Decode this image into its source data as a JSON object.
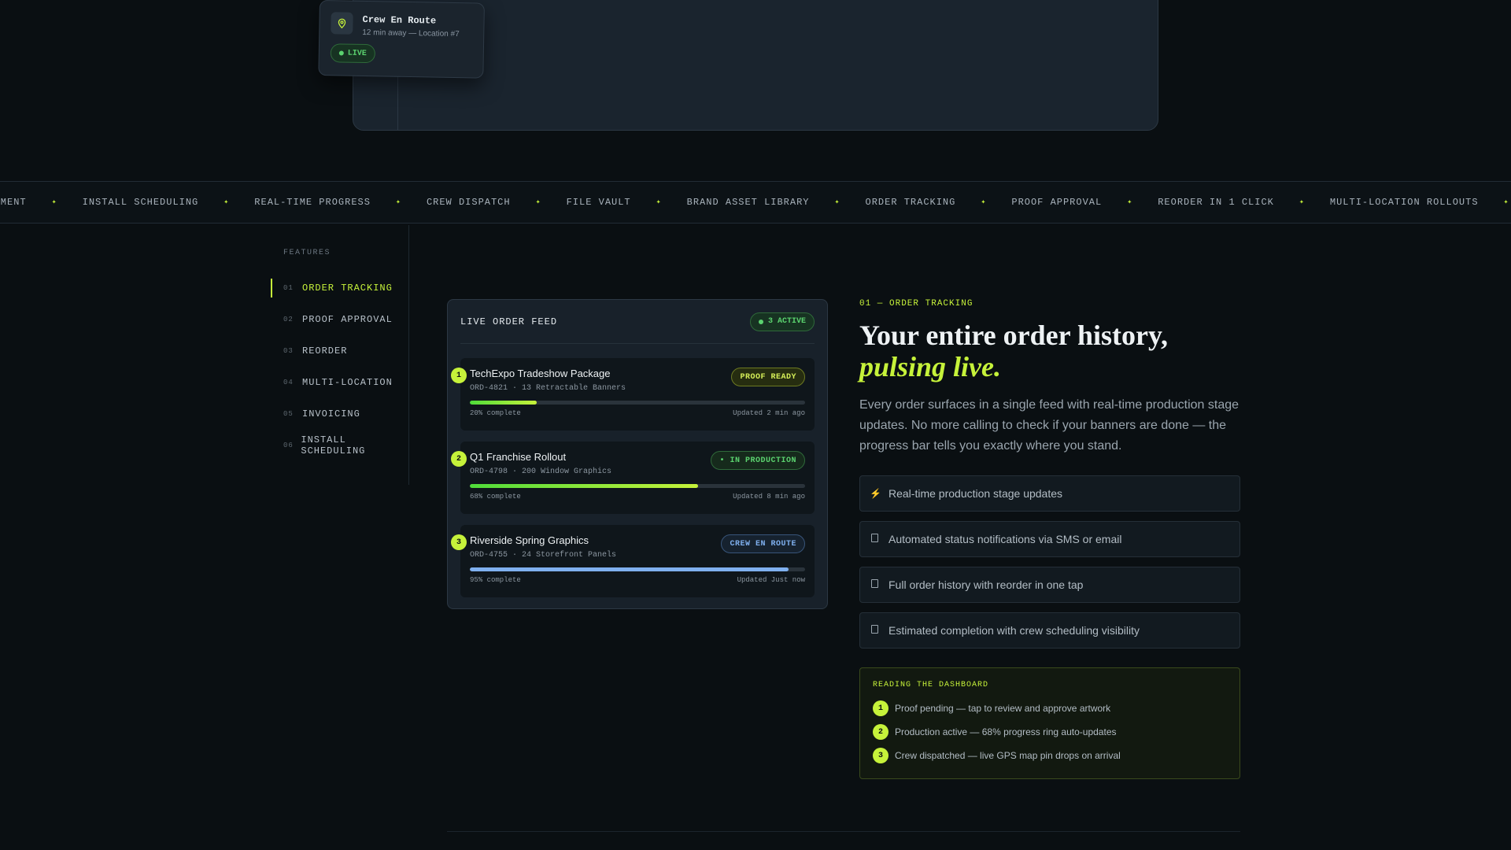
{
  "crew_card": {
    "title": "Crew En Route",
    "subtitle": "12 min away — Location #7",
    "badge": "LIVE",
    "icon": "map-pin-icon"
  },
  "marquee": [
    "NAGEMENT",
    "INSTALL SCHEDULING",
    "REAL-TIME PROGRESS",
    "CREW DISPATCH",
    "FILE VAULT",
    "BRAND ASSET LIBRARY",
    "ORDER TRACKING",
    "PROOF APPROVAL",
    "REORDER IN 1 CLICK",
    "MULTI-LOCATION ROLLOUTS"
  ],
  "marquee_separator": "✦",
  "features": {
    "label": "FEATURES",
    "items": [
      {
        "num": "01",
        "label": "ORDER TRACKING",
        "active": true
      },
      {
        "num": "02",
        "label": "PROOF APPROVAL",
        "active": false
      },
      {
        "num": "03",
        "label": "REORDER",
        "active": false
      },
      {
        "num": "04",
        "label": "MULTI-LOCATION",
        "active": false
      },
      {
        "num": "05",
        "label": "INVOICING",
        "active": false
      },
      {
        "num": "06",
        "label": "INSTALL SCHEDULING",
        "active": false
      }
    ]
  },
  "feed": {
    "title": "LIVE ORDER FEED",
    "badge": "3 ACTIVE",
    "orders": [
      {
        "step": "1",
        "name": "TechExpo Tradeshow Package",
        "meta": "ORD-4821 · 13 Retractable Banners",
        "status": "PROOF READY",
        "status_kind": "proof",
        "progress": 20,
        "progress_label": "20% complete",
        "updated": "Updated 2 min ago"
      },
      {
        "step": "2",
        "name": "Q1 Franchise Rollout",
        "meta": "ORD-4798 · 200 Window Graphics",
        "status": "• IN PRODUCTION",
        "status_kind": "prod",
        "progress": 68,
        "progress_label": "68% complete",
        "updated": "Updated 8 min ago"
      },
      {
        "step": "3",
        "name": "Riverside Spring Graphics",
        "meta": "ORD-4755 · 24 Storefront Panels",
        "status": "CREW EN ROUTE",
        "status_kind": "route",
        "progress": 95,
        "progress_label": "95% complete",
        "updated": "Updated Just now"
      }
    ]
  },
  "detail": {
    "eyebrow": "01 — ORDER TRACKING",
    "headline_plain": "Your entire order history, ",
    "headline_accent": "pulsing live.",
    "lede": "Every order surfaces in a single feed with real-time production stage updates. No more calling to check if your banners are done — the progress bar tells you exactly where you stand.",
    "benefits": [
      {
        "icon": "lightning-icon",
        "glyph": "⚡",
        "text": "Real-time production stage updates"
      },
      {
        "icon": "notification-icon",
        "glyph": "",
        "text": "Automated status notifications via SMS or email"
      },
      {
        "icon": "history-icon",
        "glyph": "",
        "text": "Full order history with reorder in one tap"
      },
      {
        "icon": "calendar-icon",
        "glyph": "",
        "text": "Estimated completion with crew scheduling visibility"
      }
    ],
    "reading": {
      "title": "READING THE DASHBOARD",
      "rows": [
        {
          "step": "1",
          "text": "Proof pending — tap to review and approve artwork"
        },
        {
          "step": "2",
          "text": "Production active — 68% progress ring auto-updates"
        },
        {
          "step": "3",
          "text": "Crew dispatched — live GPS map pin drops on arrival"
        }
      ]
    }
  },
  "colors": {
    "accent": "#c6f23a",
    "live_green": "#5bd36f",
    "route_blue": "#7fb0ef",
    "background": "#0a0f12"
  }
}
